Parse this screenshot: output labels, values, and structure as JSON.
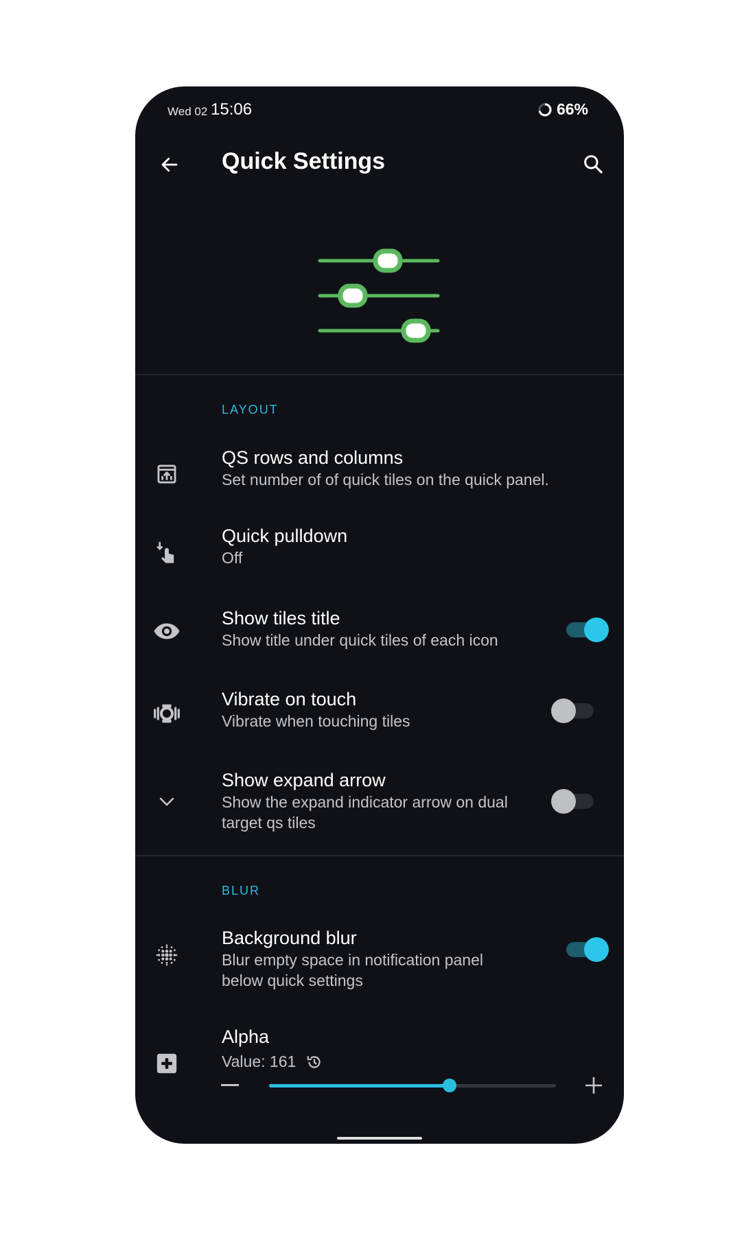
{
  "status_bar": {
    "date": "Wed 02",
    "time": "15:06",
    "battery": "66%"
  },
  "app_bar": {
    "title": "Quick Settings"
  },
  "sections": {
    "layout": {
      "header": "LAYOUT"
    },
    "blur": {
      "header": "BLUR"
    }
  },
  "items": {
    "qs_rows": {
      "title": "QS rows and columns",
      "subtitle": "Set number of of quick tiles on the quick panel."
    },
    "quick_pulldown": {
      "title": "Quick pulldown",
      "subtitle": "Off"
    },
    "show_tiles_title": {
      "title": "Show tiles title",
      "subtitle": "Show title under quick tiles of each icon",
      "enabled": true
    },
    "vibrate_on_touch": {
      "title": "Vibrate on touch",
      "subtitle": "Vibrate when touching tiles",
      "enabled": false
    },
    "show_expand_arrow": {
      "title": "Show expand arrow",
      "subtitle": "Show the expand indicator arrow on dual target qs tiles",
      "enabled": false
    },
    "background_blur": {
      "title": "Background blur",
      "subtitle": "Blur empty space in notification panel below quick settings",
      "enabled": true
    },
    "alpha": {
      "title": "Alpha",
      "value_label": "Value: 161",
      "value": 161,
      "fraction": 0.63
    }
  },
  "colors": {
    "accent": "#2bbde0",
    "background": "#0f1117",
    "hero_green": "#5cb85f"
  },
  "icons": [
    "back-arrow-icon",
    "search-icon",
    "sliders-illustration",
    "tiles-grid-icon",
    "touch-pulldown-icon",
    "eye-icon",
    "vibrate-icon",
    "chevron-down-icon",
    "blur-icon",
    "plus-box-icon",
    "reset-icon",
    "minus-icon",
    "plus-icon"
  ]
}
